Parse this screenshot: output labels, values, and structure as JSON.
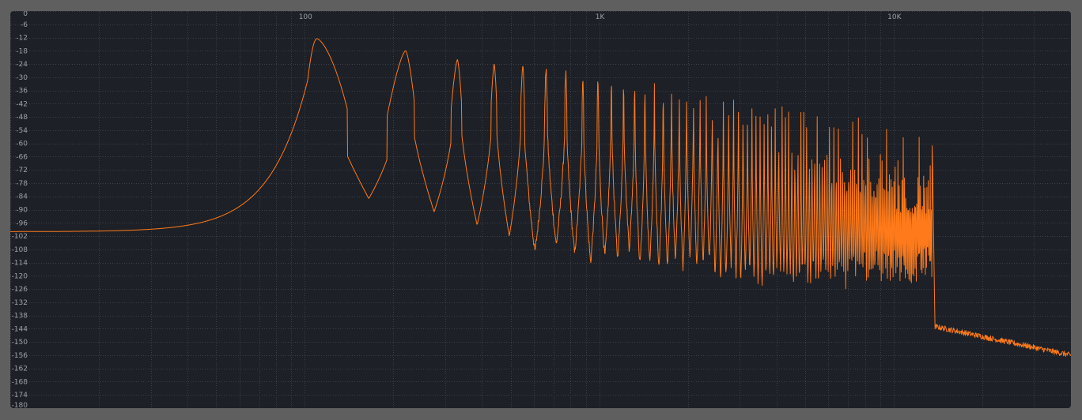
{
  "chart_data": {
    "type": "line",
    "title": "",
    "xlabel": "",
    "ylabel": "",
    "x_scale": "log",
    "xlim": [
      10,
      40000
    ],
    "ylim": [
      -180,
      0
    ],
    "grid": true,
    "x_tick_labels": [
      {
        "value": 100,
        "label": "100"
      },
      {
        "value": 1000,
        "label": "1K"
      },
      {
        "value": 10000,
        "label": "10K"
      }
    ],
    "y_ticks": [
      0,
      -6,
      -12,
      -18,
      -24,
      -30,
      -36,
      -42,
      -48,
      -54,
      -60,
      -66,
      -72,
      -78,
      -84,
      -90,
      -96,
      -102,
      -108,
      -114,
      -120,
      -126,
      -132,
      -138,
      -144,
      -150,
      -156,
      -162,
      -168,
      -174,
      -180
    ],
    "colors": {
      "background": "#1d2026",
      "frame": "#5f5f5f",
      "grid": "#3b4049",
      "line": "#ff7a1a",
      "tick_text": "#9aa0a8"
    },
    "series": [
      {
        "fundamental_hz": 110,
        "cutoff_hz": 13500,
        "points": [
          [
            10,
            -100
          ],
          [
            30,
            -98
          ],
          [
            60,
            -90
          ],
          [
            80,
            -76
          ],
          [
            95,
            -60
          ],
          [
            102,
            -45
          ],
          [
            110,
            -12.5
          ],
          [
            118,
            -35
          ],
          [
            140,
            -66
          ],
          [
            165,
            -85
          ],
          [
            220,
            -18
          ],
          [
            265,
            -91
          ],
          [
            330,
            -22
          ],
          [
            385,
            -97
          ],
          [
            440,
            -24
          ],
          [
            500,
            -102
          ],
          [
            13500,
            -55
          ],
          [
            13700,
            -143
          ],
          [
            40000,
            -157
          ]
        ]
      }
    ]
  }
}
